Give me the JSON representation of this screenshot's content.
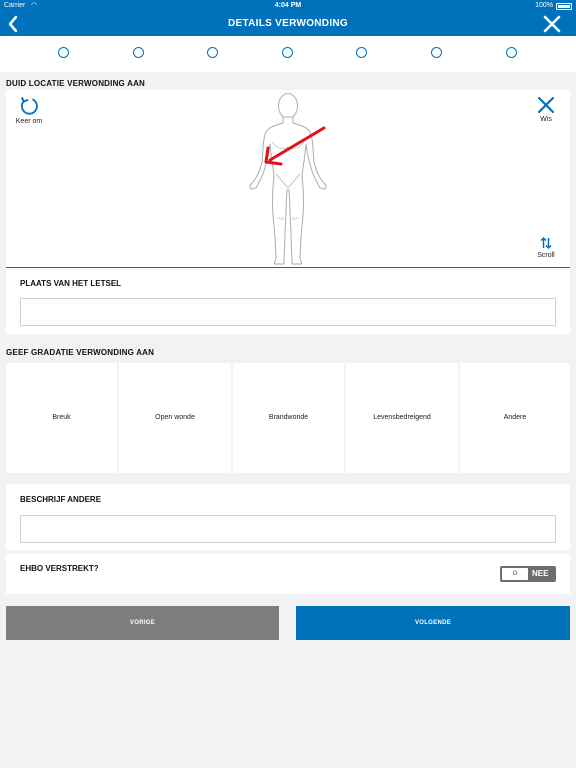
{
  "status_bar": {
    "carrier": "Carrier",
    "time": "4:04 PM",
    "battery": "100%"
  },
  "header": {
    "title": "DETAILS VERWONDING"
  },
  "stepper": {
    "total": 7,
    "active_index": 4,
    "accent": "#0072bb"
  },
  "body_map": {
    "heading": "DUID LOCATIE VERWONDING AAN",
    "flip_label": "Keer om",
    "clear_label": "Wis",
    "scroll_label": "Scroll",
    "marker_color": "#e3111b"
  },
  "location": {
    "heading": "PLAATS VAN HET LETSEL",
    "value": "",
    "placeholder": ""
  },
  "grade": {
    "heading": "GEEF GRADATIE VERWONDING AAN",
    "options": [
      "Breuk",
      "Open wonde",
      "Brandwonde",
      "Levensbedreigend",
      "Andere"
    ]
  },
  "describe": {
    "heading": "BESCHRIJF ANDERE",
    "value": "",
    "placeholder": ""
  },
  "first_aid": {
    "heading": "EHBO VERSTREKT?",
    "toggle_knob": "O",
    "toggle_label": "NEE",
    "is_on": false
  },
  "footer": {
    "prev_label": "VORIGE",
    "next_label": "VOLGENDE"
  },
  "colors": {
    "primary": "#0072bb",
    "secondary_button": "#7d7d7d",
    "background": "#f2f2f4"
  }
}
